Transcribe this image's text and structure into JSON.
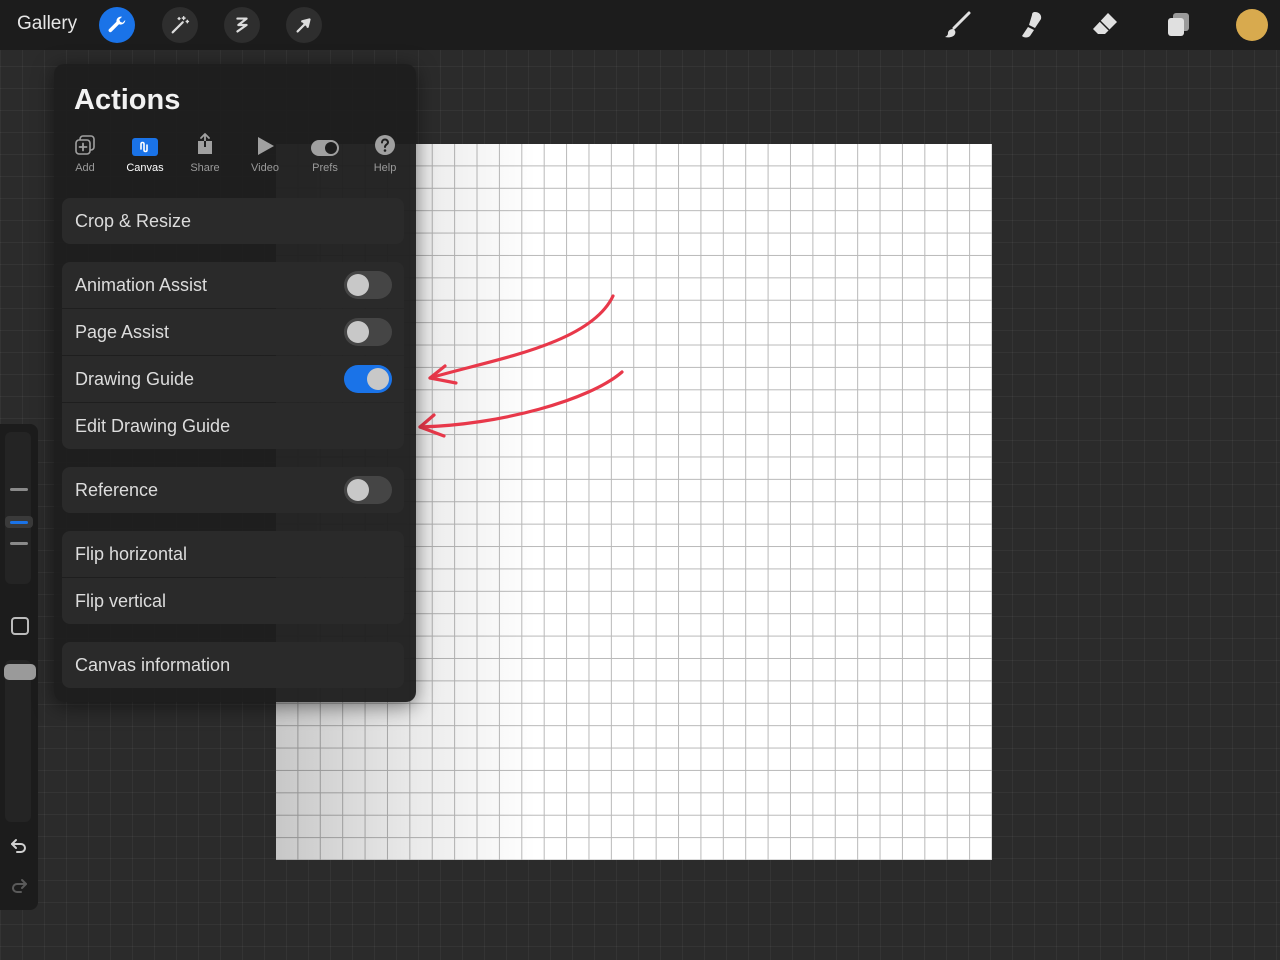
{
  "topbar": {
    "gallery_label": "Gallery",
    "left_tools": [
      "wrench-icon",
      "magic-wand-icon",
      "selection-icon",
      "transform-arrow-icon"
    ],
    "right_tools": [
      "brush-icon",
      "smudge-icon",
      "eraser-icon",
      "layers-icon"
    ],
    "current_color": "#d8aa4e"
  },
  "actions_panel": {
    "title": "Actions",
    "tabs": [
      {
        "label": "Add",
        "icon": "add-icon"
      },
      {
        "label": "Canvas",
        "icon": "canvas-icon"
      },
      {
        "label": "Share",
        "icon": "share-icon"
      },
      {
        "label": "Video",
        "icon": "play-icon"
      },
      {
        "label": "Prefs",
        "icon": "toggle-icon"
      },
      {
        "label": "Help",
        "icon": "help-icon"
      }
    ],
    "active_tab": "Canvas",
    "rows": {
      "crop_resize": "Crop & Resize",
      "animation_assist": "Animation Assist",
      "page_assist": "Page Assist",
      "drawing_guide": "Drawing Guide",
      "edit_drawing_guide": "Edit Drawing Guide",
      "reference": "Reference",
      "flip_horizontal": "Flip horizontal",
      "flip_vertical": "Flip vertical",
      "canvas_information": "Canvas information"
    },
    "toggles": {
      "animation_assist": false,
      "page_assist": false,
      "drawing_guide": true,
      "reference": false
    }
  },
  "colors": {
    "accent": "#1a73e8",
    "annotation_arrow": "#e8384a"
  }
}
